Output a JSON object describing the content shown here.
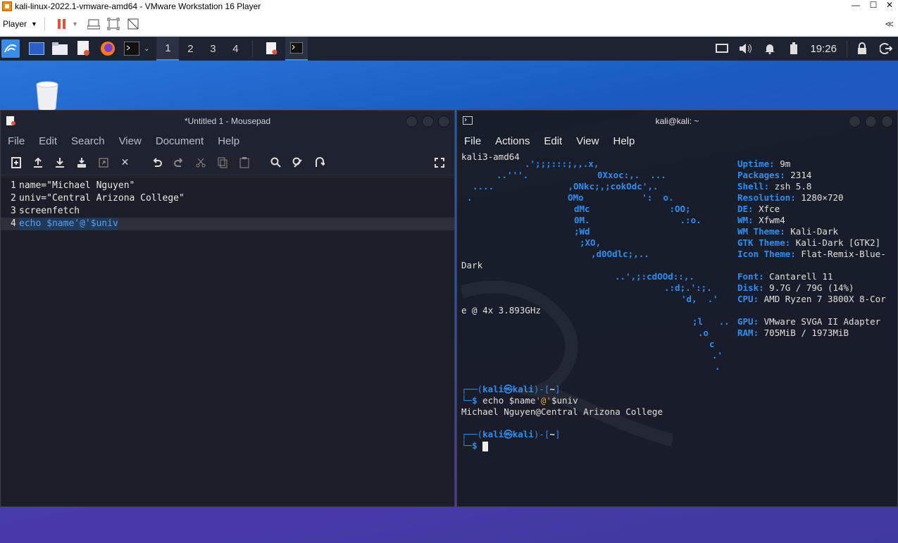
{
  "vm": {
    "title": "kali-linux-2022.1-vmware-amd64 - VMware Workstation 16 Player",
    "menu_player": "Player",
    "collapse": "≪"
  },
  "panel": {
    "workspaces": [
      "1",
      "2",
      "3",
      "4"
    ],
    "active_workspace": "1",
    "clock": "19:26"
  },
  "mousepad": {
    "title": "*Untitled 1 - Mousepad",
    "menu": [
      "File",
      "Edit",
      "Search",
      "View",
      "Document",
      "Help"
    ],
    "lines": [
      {
        "num": "1",
        "text": "name=\"Michael Nguyen\""
      },
      {
        "num": "2",
        "text": "univ=\"Central Arizona College\""
      },
      {
        "num": "3",
        "text": "screenfetch"
      },
      {
        "num": "4",
        "text": "echo $name'@'$univ"
      }
    ]
  },
  "terminal": {
    "title": "kali@kali: ~",
    "menu": [
      "File",
      "Actions",
      "Edit",
      "View",
      "Help"
    ],
    "host": "kali3-amd64",
    "info": [
      {
        "key": "Uptime:",
        "val": "9m"
      },
      {
        "key": "Packages:",
        "val": "2314"
      },
      {
        "key": "Shell:",
        "val": "zsh 5.8"
      },
      {
        "key": "Resolution:",
        "val": "1280×720"
      },
      {
        "key": "DE:",
        "val": "Xfce"
      },
      {
        "key": "WM:",
        "val": "Xfwm4"
      },
      {
        "key": "WM Theme:",
        "val": "Kali-Dark"
      },
      {
        "key": "GTK Theme:",
        "val": "Kali-Dark [GTK2]"
      },
      {
        "key": "Icon Theme:",
        "val": "Flat-Remix-Blue-"
      },
      {
        "key": "Font:",
        "val": "Cantarell 11"
      },
      {
        "key": "Disk:",
        "val": "9.7G / 79G (14%)"
      },
      {
        "key": "CPU:",
        "val": "AMD Ryzen 7 3800X 8-Cor"
      },
      {
        "key": "GPU:",
        "val": "VMware SVGA II Adapter"
      },
      {
        "key": "RAM:",
        "val": "705MiB / 1973MiB"
      }
    ],
    "wrap1": "Dark",
    "wrap2": "e @ 4x 3.893GHz",
    "art": [
      ".';;;:::;,,.x,",
      "..'''.             0Xxoc:,.  ...",
      "....              ,ONkc;,;cokOdc',.",
      ".                  OMo           ':  o.",
      "dMc               :OO;",
      "0M.                 .:o.",
      ";Wd",
      ";XO,",
      ",d0Odlc;,..",
      "..',;:cdOOd::,.",
      ".:d;.':;.",
      "'d,  .'",
      ";l   ..",
      ".o",
      "c",
      ".'",
      "."
    ],
    "prompt_user": "kali㉿kali",
    "prompt_dir": "~",
    "command_echo": "echo",
    "command_arg1": "$name",
    "command_at": "'@'",
    "command_arg2": "$univ",
    "output": "Michael Nguyen@Central Arizona College",
    "dollar": "$"
  }
}
